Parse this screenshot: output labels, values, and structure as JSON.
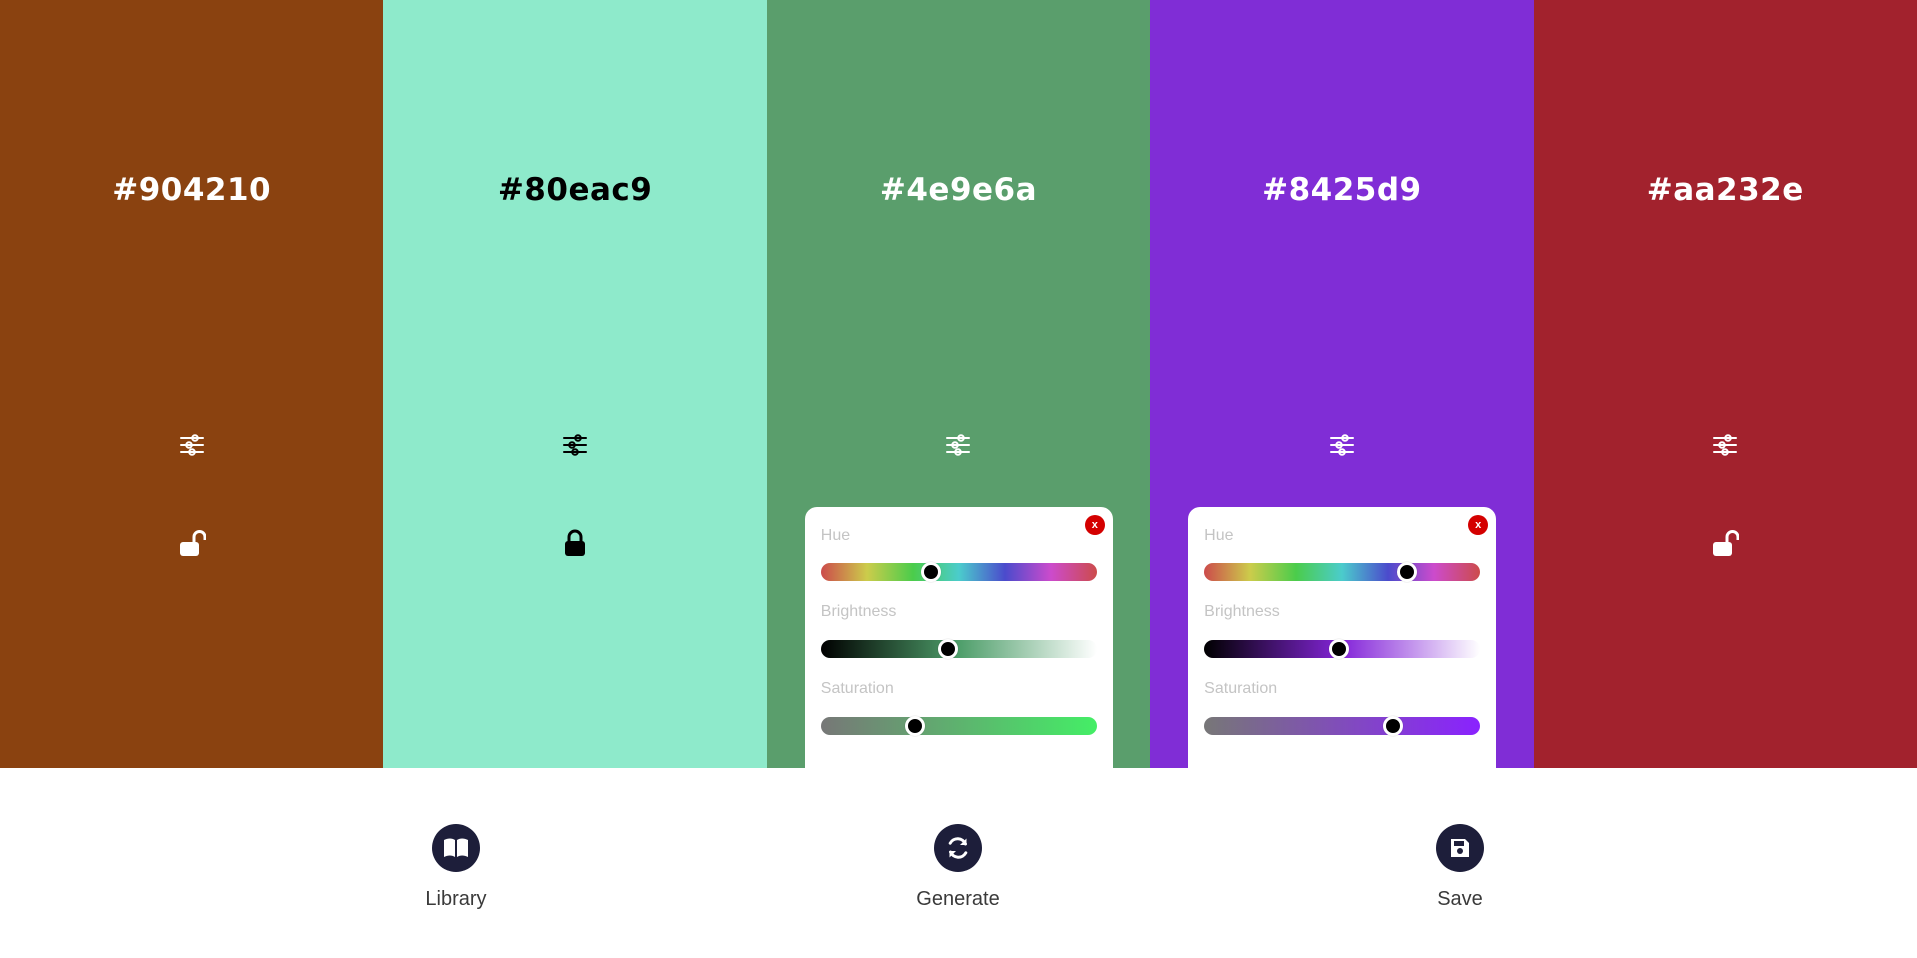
{
  "palette": [
    {
      "hex": "#904210",
      "bg": "#8a4210",
      "text_color": "#ffffff",
      "locked": false,
      "adjust_icon": "sliders-icon",
      "lock_icon": "unlock-icon",
      "panel_open": false
    },
    {
      "hex": "#80eac9",
      "bg": "#8eeacb",
      "text_color": "#000000",
      "locked": true,
      "adjust_icon": "sliders-icon",
      "lock_icon": "lock-icon",
      "panel_open": false
    },
    {
      "hex": "#4e9e6a",
      "bg": "#5a9e6c",
      "text_color": "#ffffff",
      "locked": false,
      "adjust_icon": "sliders-icon",
      "lock_icon": "unlock-icon",
      "panel_open": true,
      "sliders": {
        "close_label": "x",
        "hue_label": "Hue",
        "brightness_label": "Brightness",
        "saturation_label": "Saturation",
        "hue_value": 0.4,
        "brightness_value": 0.46,
        "saturation_value": 0.34,
        "brightness_gradient": [
          "#000000",
          "#4e9e6a",
          "#ffffff"
        ],
        "saturation_gradient": [
          "#777777",
          "#44ee66"
        ]
      }
    },
    {
      "hex": "#8425d9",
      "bg": "#802dd6",
      "text_color": "#ffffff",
      "locked": false,
      "adjust_icon": "sliders-icon",
      "lock_icon": "unlock-icon",
      "panel_open": true,
      "sliders": {
        "close_label": "x",
        "hue_label": "Hue",
        "brightness_label": "Brightness",
        "saturation_label": "Saturation",
        "hue_value": 0.735,
        "brightness_value": 0.49,
        "saturation_value": 0.685,
        "brightness_gradient": [
          "#000000",
          "#8425d9",
          "#ffffff"
        ],
        "saturation_gradient": [
          "#777777",
          "#8a22ff"
        ]
      }
    },
    {
      "hex": "#aa232e",
      "bg": "#a2222d",
      "text_color": "#ffffff",
      "locked": false,
      "adjust_icon": "sliders-icon",
      "lock_icon": "unlock-icon",
      "panel_open": false
    }
  ],
  "hue_gradient": [
    "#cc4b4b",
    "#cccc4b",
    "#4bcc4b",
    "#4bcccc",
    "#4b4bcc",
    "#cc4bcc",
    "#cc4b4b"
  ],
  "footer": {
    "library": {
      "label": "Library",
      "icon": "book-open-icon"
    },
    "generate": {
      "label": "Generate",
      "icon": "refresh-icon"
    },
    "save": {
      "label": "Save",
      "icon": "save-icon"
    },
    "button_color": "#1d1e3a"
  }
}
